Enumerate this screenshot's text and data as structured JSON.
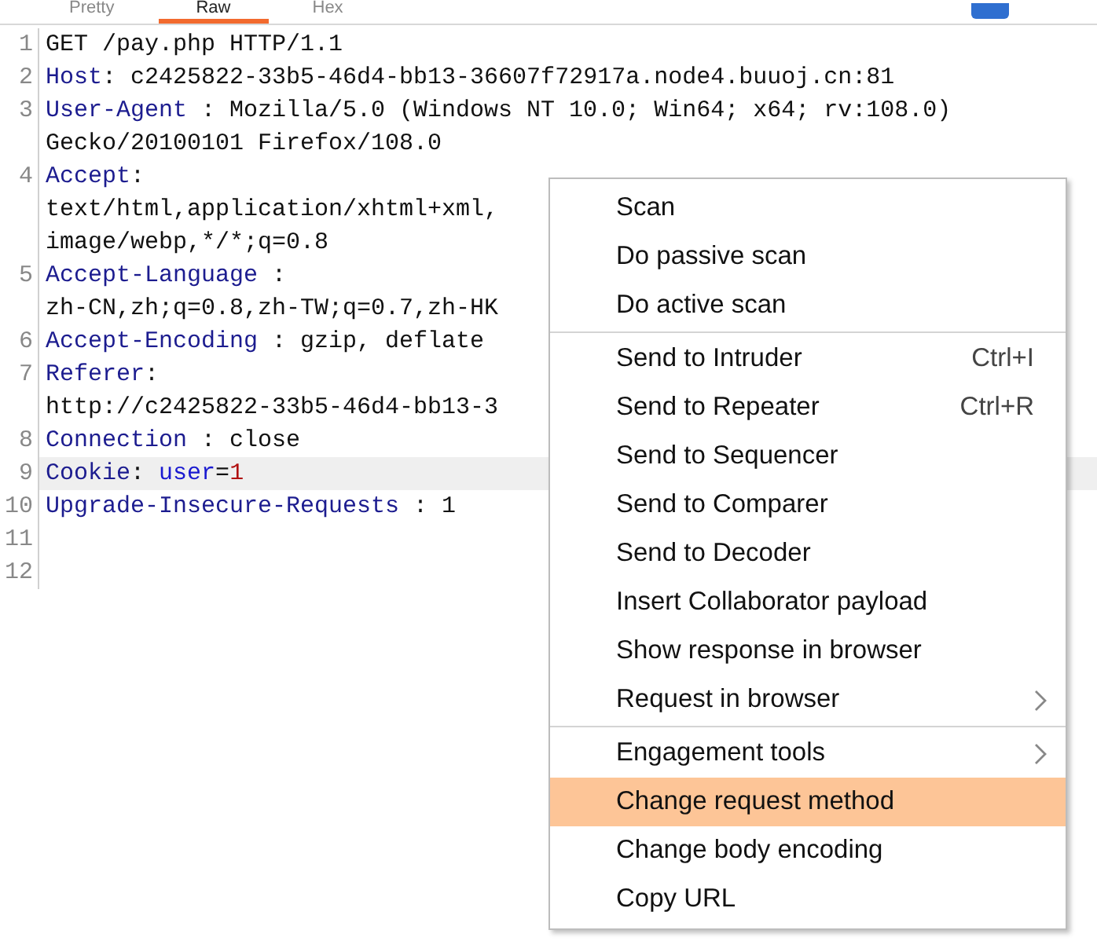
{
  "tabs": [
    {
      "label": "Pretty",
      "selected": false
    },
    {
      "label": "Raw",
      "selected": true
    },
    {
      "label": "Hex",
      "selected": false
    }
  ],
  "editor": {
    "lines": [
      {
        "number": "1",
        "current": false,
        "rows": [
          [
            {
              "kind": "plain",
              "text": "GET /pay.php HTTP/1.1"
            }
          ]
        ]
      },
      {
        "number": "2",
        "current": false,
        "rows": [
          [
            {
              "kind": "name",
              "text": "Host"
            },
            {
              "kind": "plain",
              "text": ": c2425822-33b5-46d4-bb13-36607f72917a.node4.buuoj.cn:81"
            }
          ]
        ]
      },
      {
        "number": "3",
        "current": false,
        "rows": [
          [
            {
              "kind": "name",
              "text": "User-Agent"
            },
            {
              "kind": "plain",
              "text": " : Mozilla/5.0 (Windows NT 10.0; Win64; x64; rv:108.0)"
            }
          ],
          [
            {
              "kind": "plain",
              "text": "Gecko/20100101 Firefox/108.0"
            }
          ]
        ]
      },
      {
        "number": "4",
        "current": false,
        "rows": [
          [
            {
              "kind": "name",
              "text": "Accept"
            },
            {
              "kind": "plain",
              "text": ":"
            }
          ],
          [
            {
              "kind": "plain",
              "text": "text/html,application/xhtml+xml,"
            }
          ],
          [
            {
              "kind": "plain",
              "text": "image/webp,*/*;q=0.8"
            }
          ]
        ]
      },
      {
        "number": "5",
        "current": false,
        "rows": [
          [
            {
              "kind": "name",
              "text": "Accept-Language"
            },
            {
              "kind": "plain",
              "text": " :"
            }
          ],
          [
            {
              "kind": "plain",
              "text": "zh-CN,zh;q=0.8,zh-TW;q=0.7,zh-HK"
            }
          ]
        ]
      },
      {
        "number": "6",
        "current": false,
        "rows": [
          [
            {
              "kind": "name",
              "text": "Accept-Encoding"
            },
            {
              "kind": "plain",
              "text": " : gzip, deflate"
            }
          ]
        ]
      },
      {
        "number": "7",
        "current": false,
        "rows": [
          [
            {
              "kind": "name",
              "text": "Referer"
            },
            {
              "kind": "plain",
              "text": ":"
            }
          ],
          [
            {
              "kind": "plain",
              "text": "http://c2425822-33b5-46d4-bb13-3"
            }
          ]
        ]
      },
      {
        "number": "8",
        "current": false,
        "rows": [
          [
            {
              "kind": "name",
              "text": "Connection"
            },
            {
              "kind": "plain",
              "text": " : close"
            }
          ]
        ]
      },
      {
        "number": "9",
        "current": true,
        "rows": [
          [
            {
              "kind": "name",
              "text": "Cookie"
            },
            {
              "kind": "plain",
              "text": ": "
            },
            {
              "kind": "param",
              "text": "user"
            },
            {
              "kind": "plain",
              "text": "="
            },
            {
              "kind": "number",
              "text": "1"
            }
          ]
        ]
      },
      {
        "number": "10",
        "current": false,
        "rows": [
          [
            {
              "kind": "name",
              "text": "Upgrade-Insecure-Requests"
            },
            {
              "kind": "plain",
              "text": " : 1"
            }
          ]
        ]
      },
      {
        "number": "11",
        "current": false,
        "rows": [
          []
        ]
      },
      {
        "number": "12",
        "current": false,
        "rows": [
          []
        ]
      }
    ]
  },
  "context_menu": {
    "items": [
      {
        "kind": "item",
        "label": "Scan",
        "has_submenu": false,
        "selected": false
      },
      {
        "kind": "item",
        "label": "Do passive scan",
        "has_submenu": false,
        "selected": false
      },
      {
        "kind": "item",
        "label": "Do active scan",
        "has_submenu": false,
        "selected": false
      },
      {
        "kind": "separator"
      },
      {
        "kind": "item",
        "label": "Send to Intruder",
        "shortcut": "Ctrl+I",
        "has_submenu": false,
        "selected": false
      },
      {
        "kind": "item",
        "label": "Send to Repeater",
        "shortcut": "Ctrl+R",
        "has_submenu": false,
        "selected": false
      },
      {
        "kind": "item",
        "label": "Send to Sequencer",
        "has_submenu": false,
        "selected": false
      },
      {
        "kind": "item",
        "label": "Send to Comparer",
        "has_submenu": false,
        "selected": false
      },
      {
        "kind": "item",
        "label": "Send to Decoder",
        "has_submenu": false,
        "selected": false
      },
      {
        "kind": "item",
        "label": "Insert Collaborator payload",
        "has_submenu": false,
        "selected": false
      },
      {
        "kind": "item",
        "label": "Show response in browser",
        "has_submenu": false,
        "selected": false
      },
      {
        "kind": "item",
        "label": "Request in browser",
        "has_submenu": true,
        "selected": false
      },
      {
        "kind": "separator"
      },
      {
        "kind": "item",
        "label": "Engagement tools",
        "has_submenu": true,
        "selected": false
      },
      {
        "kind": "item",
        "label": "Change request method",
        "has_submenu": false,
        "selected": true
      },
      {
        "kind": "item",
        "label": "Change body encoding",
        "has_submenu": false,
        "selected": false
      },
      {
        "kind": "item",
        "label": "Copy URL",
        "has_submenu": false,
        "selected": false
      }
    ]
  }
}
